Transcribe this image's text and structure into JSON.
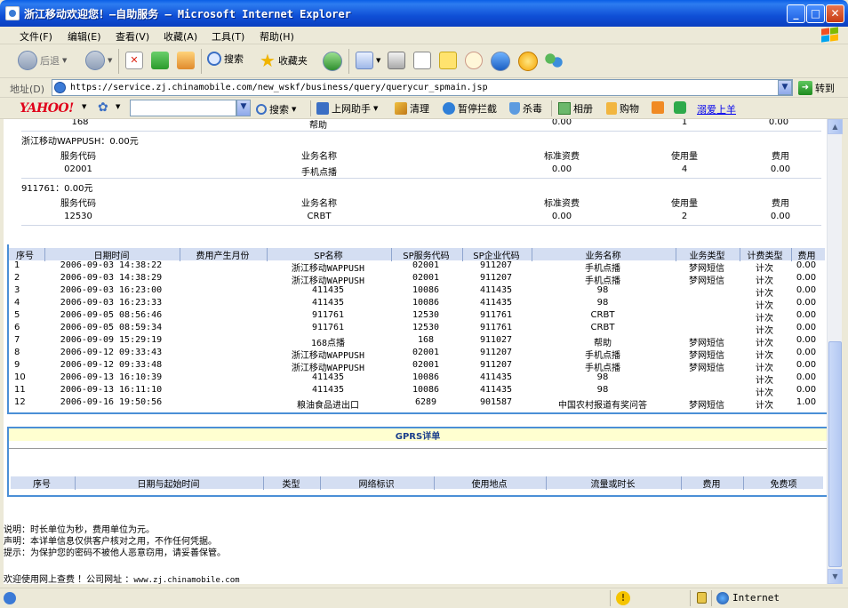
{
  "window": {
    "title": "浙江移动欢迎您！—自助服务 — Microsoft Internet Explorer",
    "min": "_",
    "max": "□",
    "close": "✕"
  },
  "menu": [
    "文件(F)",
    "编辑(E)",
    "查看(V)",
    "收藏(A)",
    "工具(T)",
    "帮助(H)"
  ],
  "toolbar": {
    "back": "后退",
    "search": "搜索",
    "favorites": "收藏夹"
  },
  "address": {
    "label": "地址(D)",
    "url": "https://service.zj.chinamobile.com/new_wskf/business/query/querycur_spmain.jsp",
    "go": "转到"
  },
  "yahoo_bar": {
    "logo": "YAHOO!",
    "search": "搜索",
    "helper": "上网助手",
    "clean": "清理",
    "block": "暂停拦截",
    "antivirus": "杀毒",
    "album": "相册",
    "shop": "购物",
    "link": "溺爱上羊"
  },
  "top_partial": {
    "name": "帮助",
    "fee": "0.00",
    "count": "1",
    "cost": "0.00",
    "id": "168"
  },
  "groups": [
    {
      "title": "浙江移动WAPPUSH：0.00元",
      "h_code": "服务代码",
      "h_name": "业务名称",
      "h_std": "标准资费",
      "h_use": "使用量",
      "h_fee": "费用",
      "code": "02001",
      "name": "手机点播",
      "std": "0.00",
      "use": "4",
      "fee": "0.00"
    },
    {
      "title": "911761：0.00元",
      "h_code": "服务代码",
      "h_name": "业务名称",
      "h_std": "标准资费",
      "h_use": "使用量",
      "h_fee": "费用",
      "code": "12530",
      "name": "CRBT",
      "std": "0.00",
      "use": "2",
      "fee": "0.00"
    }
  ],
  "detail": {
    "headers": [
      "序号",
      "日期时间",
      "费用产生月份",
      "SP名称",
      "SP服务代码",
      "SP企业代码",
      "业务名称",
      "业务类型",
      "计费类型",
      "费用"
    ],
    "rows": [
      [
        "1",
        "2006-09-03 14:38:22",
        "",
        "浙江移动WAPPUSH",
        "02001",
        "911207",
        "手机点播",
        "梦网短信",
        "计次",
        "0.00"
      ],
      [
        "2",
        "2006-09-03 14:38:29",
        "",
        "浙江移动WAPPUSH",
        "02001",
        "911207",
        "手机点播",
        "梦网短信",
        "计次",
        "0.00"
      ],
      [
        "3",
        "2006-09-03 16:23:00",
        "",
        "411435",
        "10086",
        "411435",
        "98",
        "",
        "计次",
        "0.00"
      ],
      [
        "4",
        "2006-09-03 16:23:33",
        "",
        "411435",
        "10086",
        "411435",
        "98",
        "",
        "计次",
        "0.00"
      ],
      [
        "5",
        "2006-09-05 08:56:46",
        "",
        "911761",
        "12530",
        "911761",
        "CRBT",
        "",
        "计次",
        "0.00"
      ],
      [
        "6",
        "2006-09-05 08:59:34",
        "",
        "911761",
        "12530",
        "911761",
        "CRBT",
        "",
        "计次",
        "0.00"
      ],
      [
        "7",
        "2006-09-09 15:29:19",
        "",
        "168点播",
        "168",
        "911027",
        "帮助",
        "梦网短信",
        "计次",
        "0.00"
      ],
      [
        "8",
        "2006-09-12 09:33:43",
        "",
        "浙江移动WAPPUSH",
        "02001",
        "911207",
        "手机点播",
        "梦网短信",
        "计次",
        "0.00"
      ],
      [
        "9",
        "2006-09-12 09:33:48",
        "",
        "浙江移动WAPPUSH",
        "02001",
        "911207",
        "手机点播",
        "梦网短信",
        "计次",
        "0.00"
      ],
      [
        "10",
        "2006-09-13 16:10:39",
        "",
        "411435",
        "10086",
        "411435",
        "98",
        "",
        "计次",
        "0.00"
      ],
      [
        "11",
        "2006-09-13 16:11:10",
        "",
        "411435",
        "10086",
        "411435",
        "98",
        "",
        "计次",
        "0.00"
      ],
      [
        "12",
        "2006-09-16 19:50:56",
        "",
        "粮油食品进出口",
        "6289",
        "901587",
        "中国农村报道有奖问答",
        "梦网短信",
        "计次",
        "1.00"
      ]
    ]
  },
  "gprs": {
    "title": "GPRS详单",
    "headers": [
      "序号",
      "日期与起始时间",
      "类型",
      "网络标识",
      "使用地点",
      "流量或时长",
      "费用",
      "免费项"
    ]
  },
  "notes": [
    "说明：时长单位为秒，费用单位为元。",
    "声明：本详单信息仅供客户核对之用，不作任何凭据。",
    "提示：为保护您的密码不被他人恶意窃用，请妥善保管。"
  ],
  "footer": {
    "text": "欢迎使用网上查费 ！公司网址 ：",
    "url": "www.zj.chinamobile.com"
  },
  "status": {
    "zone": "Internet"
  }
}
